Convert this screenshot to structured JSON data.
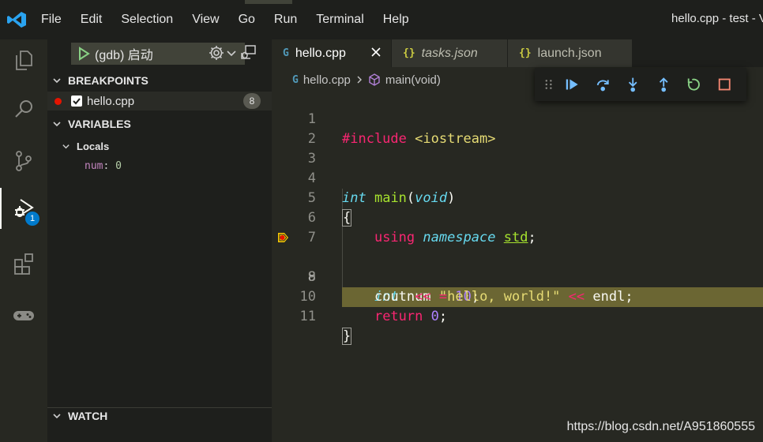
{
  "titlebar": {
    "menu": [
      "File",
      "Edit",
      "Selection",
      "View",
      "Go",
      "Run",
      "Terminal",
      "Help"
    ],
    "title": "hello.cpp - test - Vi"
  },
  "activity": {
    "items": [
      "explorer-icon",
      "search-icon",
      "source-control-icon",
      "run-debug-icon",
      "extensions-icon",
      "gamepad-icon"
    ],
    "debug_badge": "1"
  },
  "sidebar": {
    "launch_config": "(gdb) 启动",
    "sections": {
      "breakpoints": "BREAKPOINTS",
      "variables": "VARIABLES",
      "watch": "WATCH"
    },
    "breakpoint": {
      "file": "hello.cpp",
      "line": "8",
      "enabled": true
    },
    "locals": {
      "label": "Locals",
      "vars": [
        {
          "name": "num",
          "sep": ": ",
          "value": "0"
        }
      ]
    }
  },
  "tabs": [
    {
      "icon": "G",
      "label": "hello.cpp",
      "active": true,
      "italic": false
    },
    {
      "icon": "{}",
      "label": "tasks.json",
      "active": false,
      "italic": true
    },
    {
      "icon": "{}",
      "label": "launch.json",
      "active": false,
      "italic": false
    }
  ],
  "breadcrumb": {
    "file": "hello.cpp",
    "symbol": "main(void)"
  },
  "debug_toolbar": [
    "continue-icon",
    "step-over-icon",
    "step-into-icon",
    "step-out-icon",
    "restart-icon",
    "stop-icon"
  ],
  "editor": {
    "current_line": 8,
    "lines": [
      {
        "n": "1"
      },
      {
        "n": "2"
      },
      {
        "n": "3"
      },
      {
        "n": "4"
      },
      {
        "n": "5"
      },
      {
        "n": "6"
      },
      {
        "n": "7"
      },
      {
        "n": "8"
      },
      {
        "n": "9"
      },
      {
        "n": "10"
      },
      {
        "n": "11"
      }
    ],
    "tokens": {
      "l1_pre": "#include",
      "l1_inc": "<iostream>",
      "l4_type": "int",
      "l4_fn": "main",
      "l4_paren_open": "(",
      "l4_arg": "void",
      "l4_paren_close": ")",
      "l5_brace": "{",
      "l6_using": "using",
      "l6_ns": "namespace",
      "l6_std": "std",
      "l6_semi": ";",
      "l8_type": "int",
      "l8_var": "num",
      "l8_eq": "=",
      "l8_num": "10",
      "l8_semi": ";",
      "l9_cout": "cout",
      "l9_op1": "<<",
      "l9_str": "\"hello, world!\"",
      "l9_op2": "<<",
      "l9_endl": "endl",
      "l9_semi": ";",
      "l10_ret": "return",
      "l10_num": "0",
      "l10_semi": ";",
      "l11_brace": "}"
    }
  },
  "watermark": "https://blog.csdn.net/A951860555"
}
